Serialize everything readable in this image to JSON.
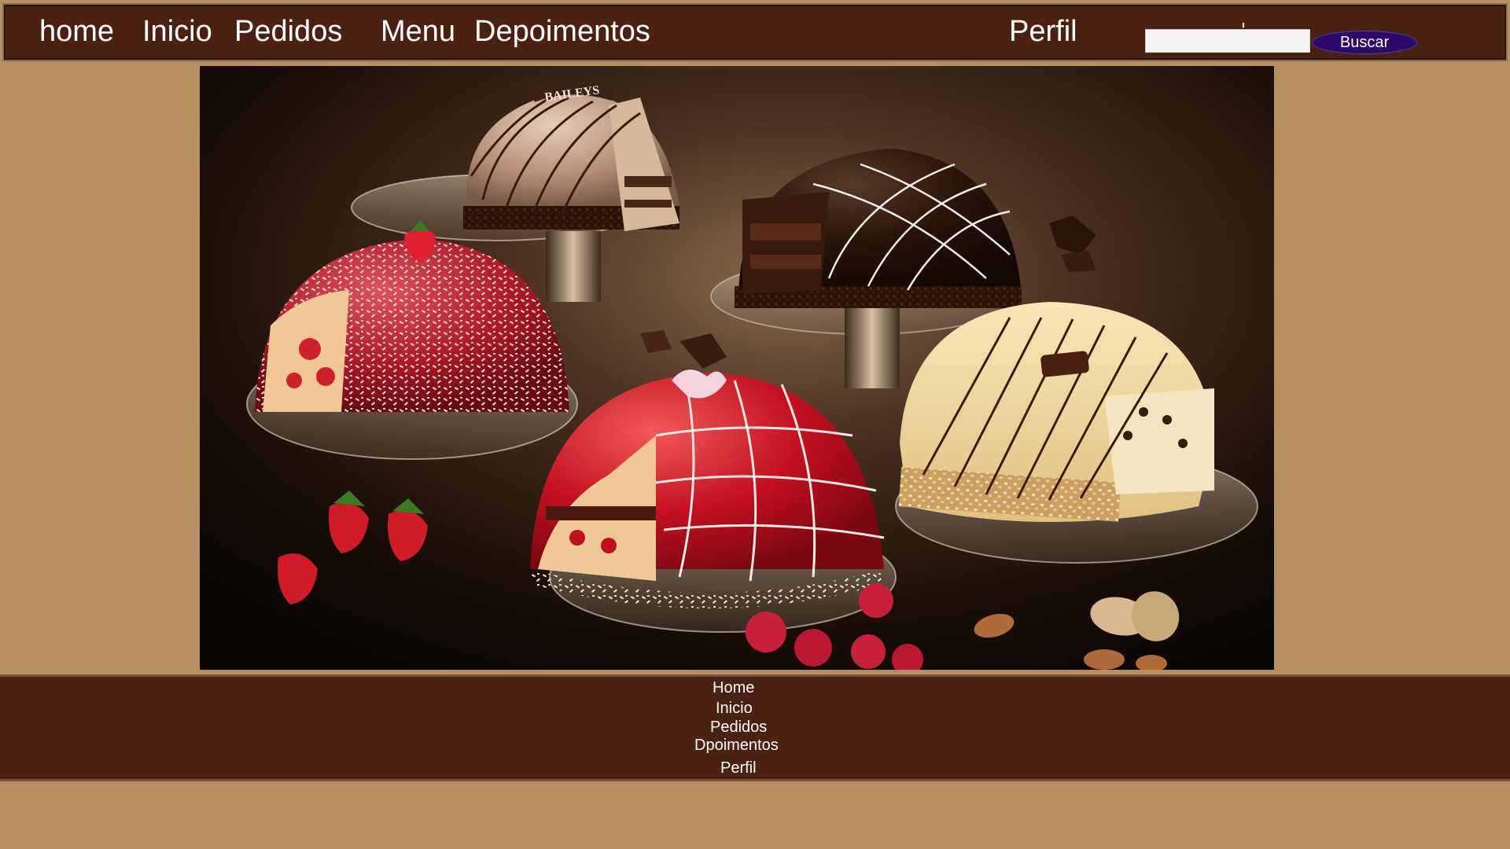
{
  "nav": {
    "items": [
      {
        "label": "home"
      },
      {
        "label": "Inicio"
      },
      {
        "label": "Pedidos"
      },
      {
        "label": "Menu"
      },
      {
        "label": "Depoimentos"
      },
      {
        "label": "Perfil"
      }
    ],
    "search": {
      "value": "",
      "placeholder": "",
      "button_label": "Buscar"
    }
  },
  "hero": {
    "image": "cakes-photo",
    "brand_text": "BAILEYS"
  },
  "footer": {
    "items": [
      {
        "label": "Home"
      },
      {
        "label": "Inicio"
      },
      {
        "label": "Pedidos"
      },
      {
        "label": "Dpoimentos"
      },
      {
        "label": "Perfil"
      }
    ]
  },
  "colors": {
    "page_background": "#b88e63",
    "bar_background": "#4b2212",
    "button_background": "#2c0a6b",
    "text": "#ffffff"
  }
}
